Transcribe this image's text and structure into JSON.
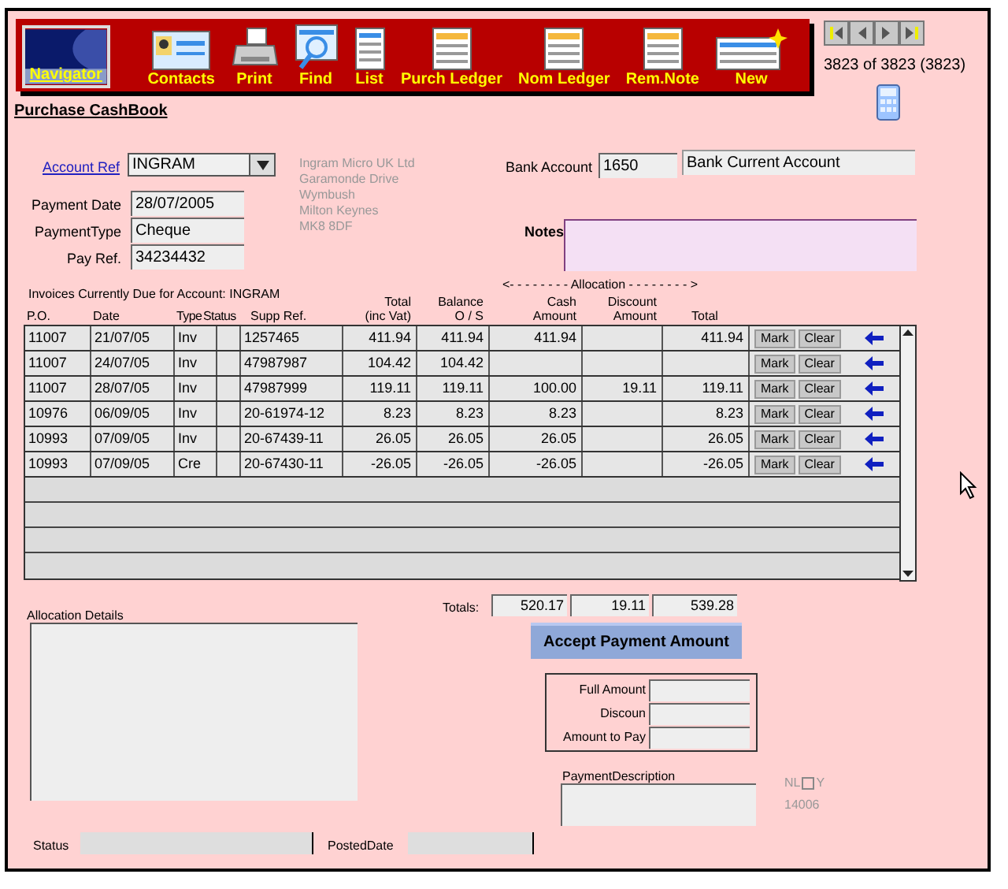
{
  "toolbar": {
    "items": [
      {
        "kind": "navigator",
        "label": "Navigator",
        "selected": true
      },
      {
        "kind": "contacts",
        "label": "Contacts",
        "selected": false
      },
      {
        "kind": "print",
        "label": "Print",
        "selected": false
      },
      {
        "kind": "find",
        "label": "Find",
        "selected": false
      },
      {
        "kind": "list",
        "label": "List",
        "selected": false
      },
      {
        "kind": "ledger",
        "label": "Purch Ledger",
        "selected": false
      },
      {
        "kind": "ledger",
        "label": "Nom Ledger",
        "selected": false
      },
      {
        "kind": "ledger",
        "label": "Rem.Note",
        "selected": false
      },
      {
        "kind": "new",
        "label": "New",
        "selected": false
      }
    ]
  },
  "record_nav": {
    "counter": "3823 of 3823 (3823)"
  },
  "title": "Purchase CashBook",
  "form": {
    "account_ref": {
      "label": "Account Ref",
      "value": "INGRAM"
    },
    "payment_date": {
      "label": "Payment Date",
      "value": "28/07/2005"
    },
    "payment_type": {
      "label": "PaymentType",
      "value": "Cheque"
    },
    "pay_ref": {
      "label": "Pay Ref.",
      "value": "34234432"
    },
    "address": [
      "Ingram Micro UK Ltd",
      "Garamonde Drive",
      "Wymbush",
      "Milton Keynes",
      "MK8 8DF"
    ],
    "bank_account": {
      "label": "Bank Account",
      "code": "1650",
      "name": "Bank Current Account"
    },
    "notes": {
      "label": "Notes"
    }
  },
  "invoices": {
    "caption": "Invoices Currently Due for Account: INGRAM",
    "allocation_label": "<- - - - - - - -  Allocation - - - - - - - - >",
    "columns": [
      {
        "label": "P.O."
      },
      {
        "label": "Date"
      },
      {
        "label": "Type"
      },
      {
        "label": "Status"
      },
      {
        "label": "Supp Ref."
      },
      {
        "label": "Total",
        "second_line": "(inc Vat)"
      },
      {
        "label": "Balance",
        "second_line": "O / S"
      },
      {
        "label": "Cash",
        "second_line": "Amount"
      },
      {
        "label": "Discount",
        "second_line": "Amount"
      },
      {
        "label": "Total"
      }
    ],
    "rows": [
      {
        "cells": [
          "11007",
          "21/07/05",
          "Inv",
          "",
          "1257465",
          "411.94",
          "411.94",
          "411.94",
          "",
          "411.94"
        ],
        "buttons": [
          "Mark",
          "Clear"
        ]
      },
      {
        "cells": [
          "11007",
          "24/07/05",
          "Inv",
          "",
          "47987987",
          "104.42",
          "104.42",
          "",
          "",
          ""
        ],
        "buttons": [
          "Mark",
          "Clear"
        ]
      },
      {
        "cells": [
          "11007",
          "28/07/05",
          "Inv",
          "",
          "47987999",
          "119.11",
          "119.11",
          "100.00",
          "19.11",
          "119.11"
        ],
        "buttons": [
          "Mark",
          "Clear"
        ]
      },
      {
        "cells": [
          "10976",
          "06/09/05",
          "Inv",
          "",
          "20-61974-12",
          "8.23",
          "8.23",
          "8.23",
          "",
          "8.23"
        ],
        "buttons": [
          "Mark",
          "Clear"
        ]
      },
      {
        "cells": [
          "10993",
          "07/09/05",
          "Inv",
          "",
          "20-67439-11",
          "26.05",
          "26.05",
          "26.05",
          "",
          "26.05"
        ],
        "buttons": [
          "Mark",
          "Clear"
        ]
      },
      {
        "cells": [
          "10993",
          "07/09/05",
          "Cre",
          "",
          "20-67430-11",
          "-26.05",
          "-26.05",
          "-26.05",
          "",
          "-26.05"
        ],
        "buttons": [
          "Mark",
          "Clear"
        ]
      }
    ]
  },
  "totals": {
    "label": "Totals:",
    "values": [
      "520.17",
      "19.11",
      "539.28"
    ]
  },
  "accept_button": "Accept Payment Amount",
  "amounts": [
    {
      "label": "Full Amount"
    },
    {
      "label": "Discoun"
    },
    {
      "label": "Amount to Pay"
    }
  ],
  "payment_description": {
    "label": "PaymentDescription"
  },
  "nl_flag": {
    "left": "NL",
    "right": "Y",
    "checked": false,
    "code": "14006"
  },
  "allocation_details": {
    "label": "Allocation Details"
  },
  "status": {
    "label": "Status"
  },
  "posted_date": {
    "label": "PostedDate"
  }
}
